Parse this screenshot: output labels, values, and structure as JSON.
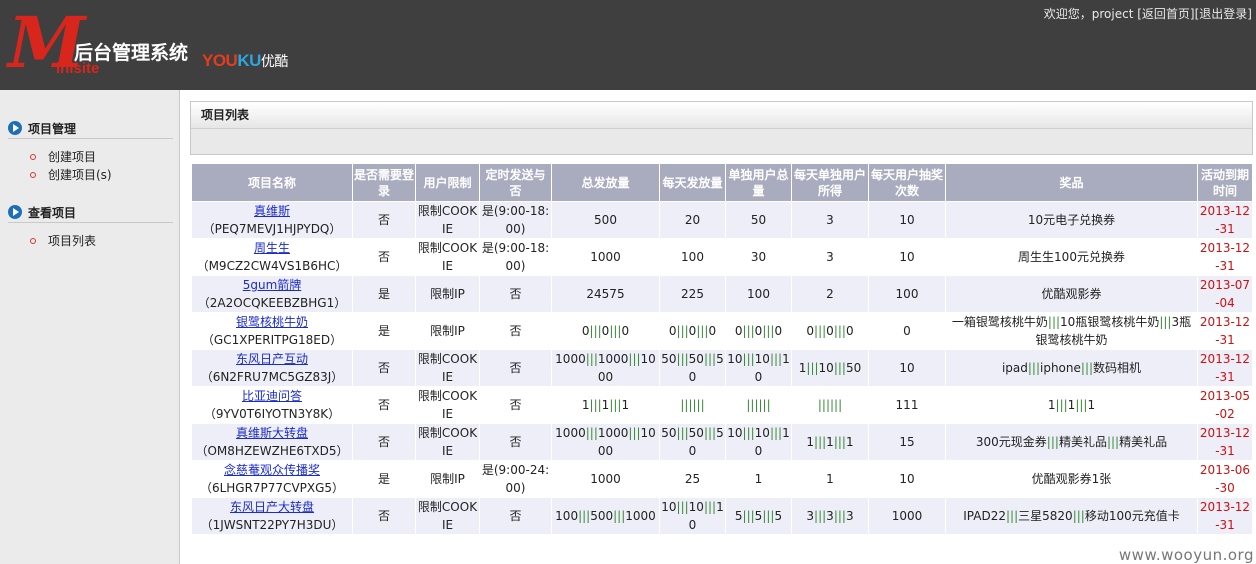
{
  "header": {
    "logo_m": "M",
    "logo_minisite": "inisite",
    "logo_title": "后台管理系统",
    "youku_you": "YOU",
    "youku_ku": "KU",
    "youku_cn": "优酷",
    "welcome": "欢迎您，project",
    "home_link": "[返回首页]",
    "logout_link": "[退出登录]"
  },
  "sidebar": {
    "groups": [
      {
        "title": "项目管理",
        "items": [
          "创建项目",
          "创建项目(s)"
        ]
      },
      {
        "title": "查看项目",
        "items": [
          "项目列表"
        ]
      }
    ]
  },
  "panel": {
    "title": "项目列表"
  },
  "table": {
    "columns": [
      "项目名称",
      "是否需要登录",
      "用户限制",
      "定时发送与否",
      "总发放量",
      "每天发放量",
      "单独用户总量",
      "每天单独用户所得",
      "每天用户抽奖次数",
      "奖品",
      "活动到期时间"
    ],
    "rows": [
      {
        "name": "真维斯",
        "code": "（PEQ7MEVJ1HJPYDQ）",
        "login": "否",
        "limit": "限制COOKIE",
        "timed": "是(9:00-18:00)",
        "total": "500",
        "daily": "20",
        "user_total": "50",
        "user_daily": "3",
        "draws": "10",
        "prize": "10元电子兑换券",
        "expire": "2013-12-31"
      },
      {
        "name": "周生生",
        "code": "（M9CZ2CW4VS1B6HC）",
        "login": "否",
        "limit": "限制COOKIE",
        "timed": "是(9:00-18:00)",
        "total": "1000",
        "daily": "100",
        "user_total": "30",
        "user_daily": "3",
        "draws": "10",
        "prize": "周生生100元兑换券",
        "expire": "2013-12-31"
      },
      {
        "name": "5gum箭牌",
        "code": "（2A2OCQKEEBZBHG1）",
        "login": "是",
        "limit": "限制IP",
        "timed": "否",
        "total": "24575",
        "daily": "225",
        "user_total": "100",
        "user_daily": "2",
        "draws": "100",
        "prize": "优酷观影券",
        "expire": "2013-07-04"
      },
      {
        "name": "银鹭核桃牛奶",
        "code": "（GC1XPERITPG18ED）",
        "login": "是",
        "limit": "限制IP",
        "timed": "否",
        "total": "0|||0|||0",
        "daily": "0|||0|||0",
        "user_total": "0|||0|||0",
        "user_daily": "0|||0|||0",
        "draws": "0",
        "prize": "一箱银鹭核桃牛奶|||10瓶银鹭核桃牛奶|||3瓶银鹭核桃牛奶",
        "expire": "2013-12-31"
      },
      {
        "name": "东风日产互动",
        "code": "（6N2FRU7MC5GZ83J）",
        "login": "否",
        "limit": "限制COOKIE",
        "timed": "否",
        "total": "1000|||1000|||1000",
        "daily": "50|||50|||50",
        "user_total": "10|||10|||10",
        "user_daily": "1|||10|||50",
        "draws": "10",
        "prize": "ipad|||iphone|||数码相机",
        "expire": "2013-12-31"
      },
      {
        "name": "比亚迪问答",
        "code": "（9YV0T6IYOTN3Y8K）",
        "login": "否",
        "limit": "限制COOKIE",
        "timed": "否",
        "total": "1|||1|||1",
        "daily": "||||||",
        "user_total": "||||||",
        "user_daily": "||||||",
        "draws": "111",
        "prize": "1|||1|||1",
        "expire": "2013-05-02"
      },
      {
        "name": "真维斯大转盘",
        "code": "（OM8HZEWZHE6TXD5）",
        "login": "否",
        "limit": "限制COOKIE",
        "timed": "否",
        "total": "1000|||1000|||1000",
        "daily": "50|||50|||50",
        "user_total": "10|||10|||10",
        "user_daily": "1|||1|||1",
        "draws": "15",
        "prize": "300元现金券|||精美礼品|||精美礼品",
        "expire": "2013-12-31"
      },
      {
        "name": "念慈菴观众传播奖",
        "code": "（6LHGR7P77CVPXG5）",
        "login": "是",
        "limit": "限制IP",
        "timed": "是(9:00-24:00)",
        "total": "1000",
        "daily": "25",
        "user_total": "1",
        "user_daily": "1",
        "draws": "10",
        "prize": "优酷观影券1张",
        "expire": "2013-06-30"
      },
      {
        "name": "东风日产大转盘",
        "code": "（1JWSNT22PY7H3DU）",
        "login": "否",
        "limit": "限制COOKIE",
        "timed": "否",
        "total": "100|||500|||1000",
        "daily": "10|||10|||10",
        "user_total": "5|||5|||5",
        "user_daily": "3|||3|||3",
        "draws": "1000",
        "prize": "IPAD22|||三星5820|||移动100元充值卡",
        "expire": "2013-12-31"
      }
    ]
  },
  "watermark": "www.wooyun.org",
  "colors": {
    "header_bg": "#3f3f3f",
    "table_header": "#a9acbf",
    "date_red": "#cc1111",
    "link_blue": "#1a2ccc"
  }
}
